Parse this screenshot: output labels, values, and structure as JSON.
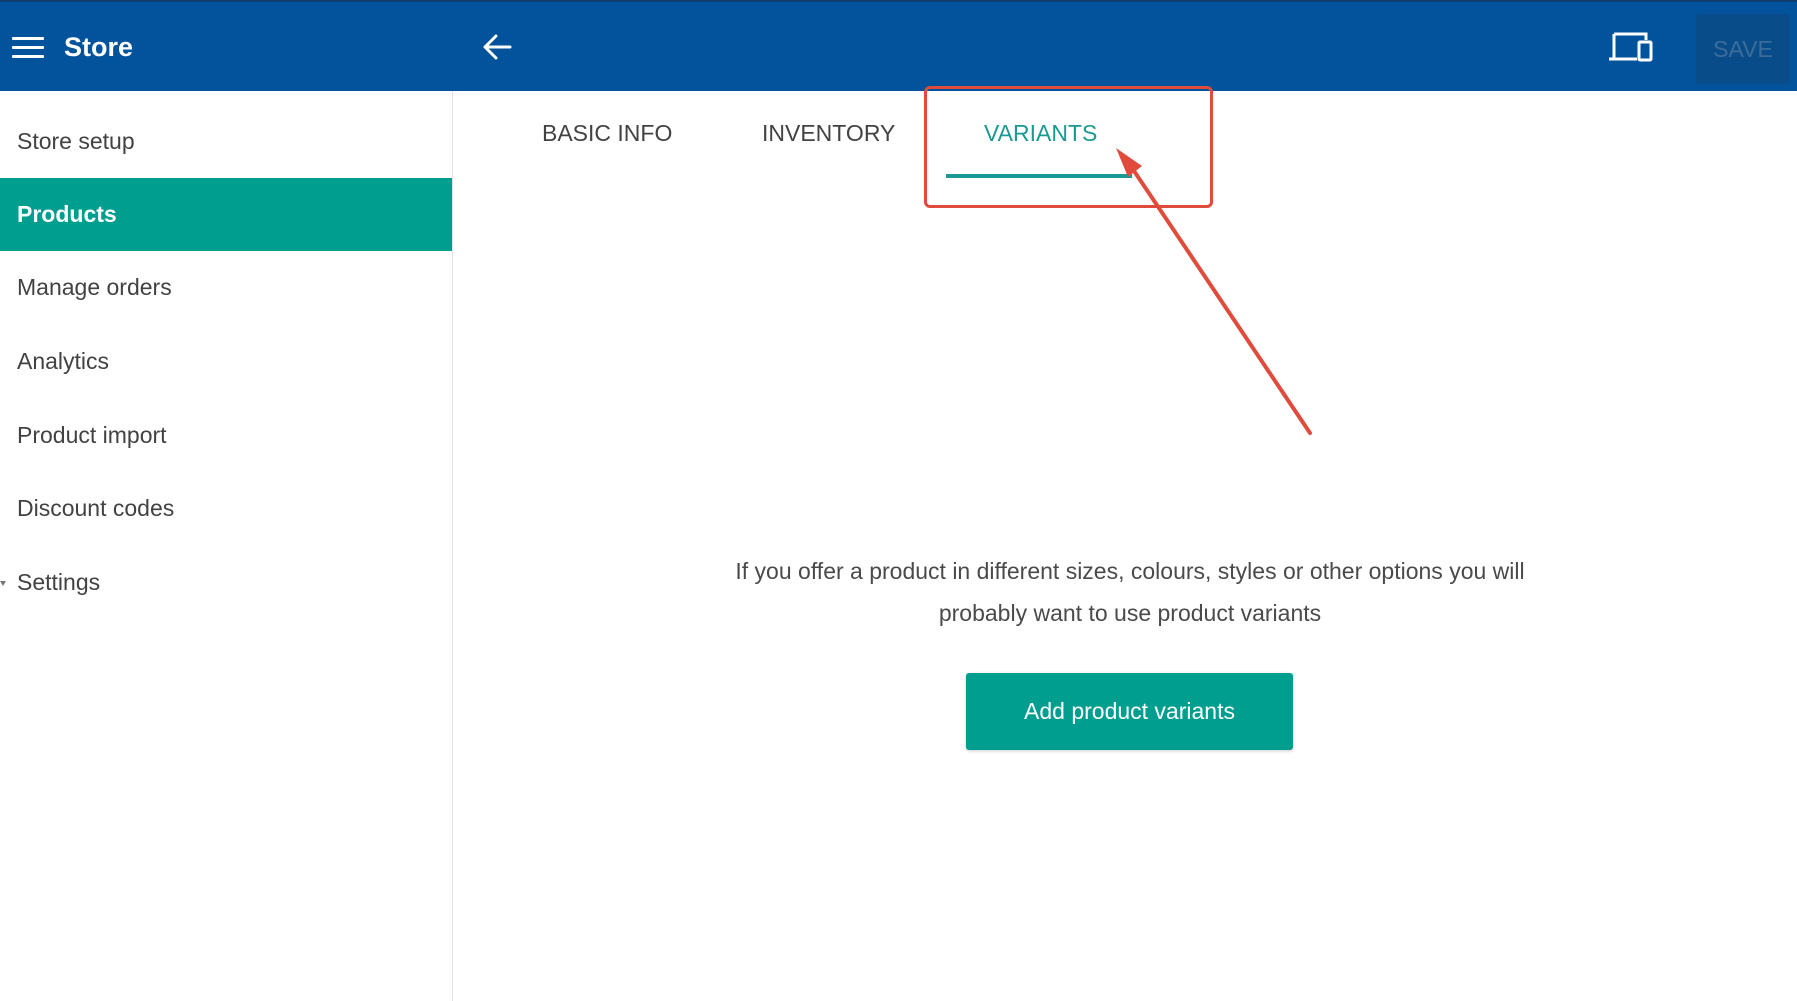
{
  "header": {
    "title": "Store",
    "menu_icon": "hamburger-menu-icon",
    "back_icon": "arrow-left-icon",
    "device_icon": "device-preview-icon",
    "save_label": "SAVE",
    "color": "#02529c"
  },
  "sidebar": {
    "items": [
      {
        "label": "Store setup"
      },
      {
        "label": "Products"
      },
      {
        "label": "Manage orders"
      },
      {
        "label": "Analytics"
      },
      {
        "label": "Product import"
      },
      {
        "label": "Discount codes"
      },
      {
        "label": "Settings"
      }
    ],
    "active_item": "Products",
    "active_color": "#009e8f"
  },
  "tabs": {
    "items": [
      {
        "label": "BASIC INFO"
      },
      {
        "label": "INVENTORY"
      },
      {
        "label": "VARIANTS"
      }
    ],
    "active_tab": "VARIANTS",
    "active_color": "#1a9a92"
  },
  "main": {
    "info_line1": "If you offer a product in different sizes, colours, styles or other options you will",
    "info_line2": "probably want to use product variants",
    "add_variants_label": "Add product variants"
  },
  "annotation": {
    "color": "#e04b3c"
  }
}
